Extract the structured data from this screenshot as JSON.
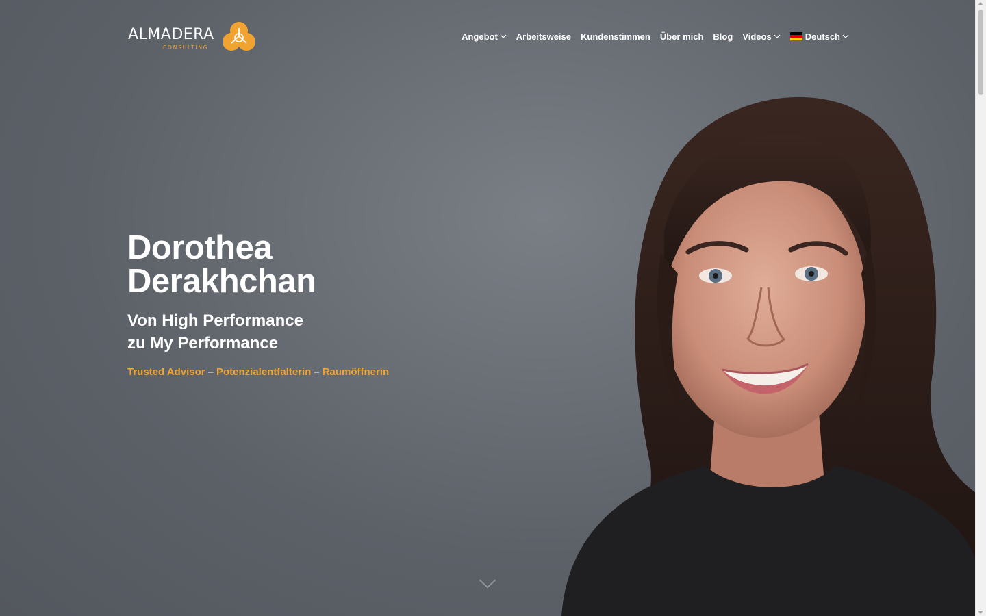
{
  "brand": {
    "name": "ALMADERA",
    "tagline": "CONSULTING",
    "accent_color": "#f0a330"
  },
  "nav": {
    "items": [
      {
        "label": "Angebot",
        "has_dropdown": true
      },
      {
        "label": "Arbeitsweise",
        "has_dropdown": false
      },
      {
        "label": "Kundenstimmen",
        "has_dropdown": false
      },
      {
        "label": "Über mich",
        "has_dropdown": false
      },
      {
        "label": "Blog",
        "has_dropdown": false
      },
      {
        "label": "Videos",
        "has_dropdown": true
      }
    ],
    "language": {
      "label": "Deutsch",
      "flag": "de-flag-icon"
    }
  },
  "hero": {
    "name_line1": "Dorothea",
    "name_line2": "Derakhchan",
    "subtitle_line1": "Von High Performance",
    "subtitle_line2": "zu My Performance",
    "tags": [
      "Trusted Advisor",
      "Potenzialentfalterin",
      "Raumöffnerin"
    ],
    "separator": "–"
  },
  "icons": {
    "scroll": "chevron-down-icon"
  }
}
